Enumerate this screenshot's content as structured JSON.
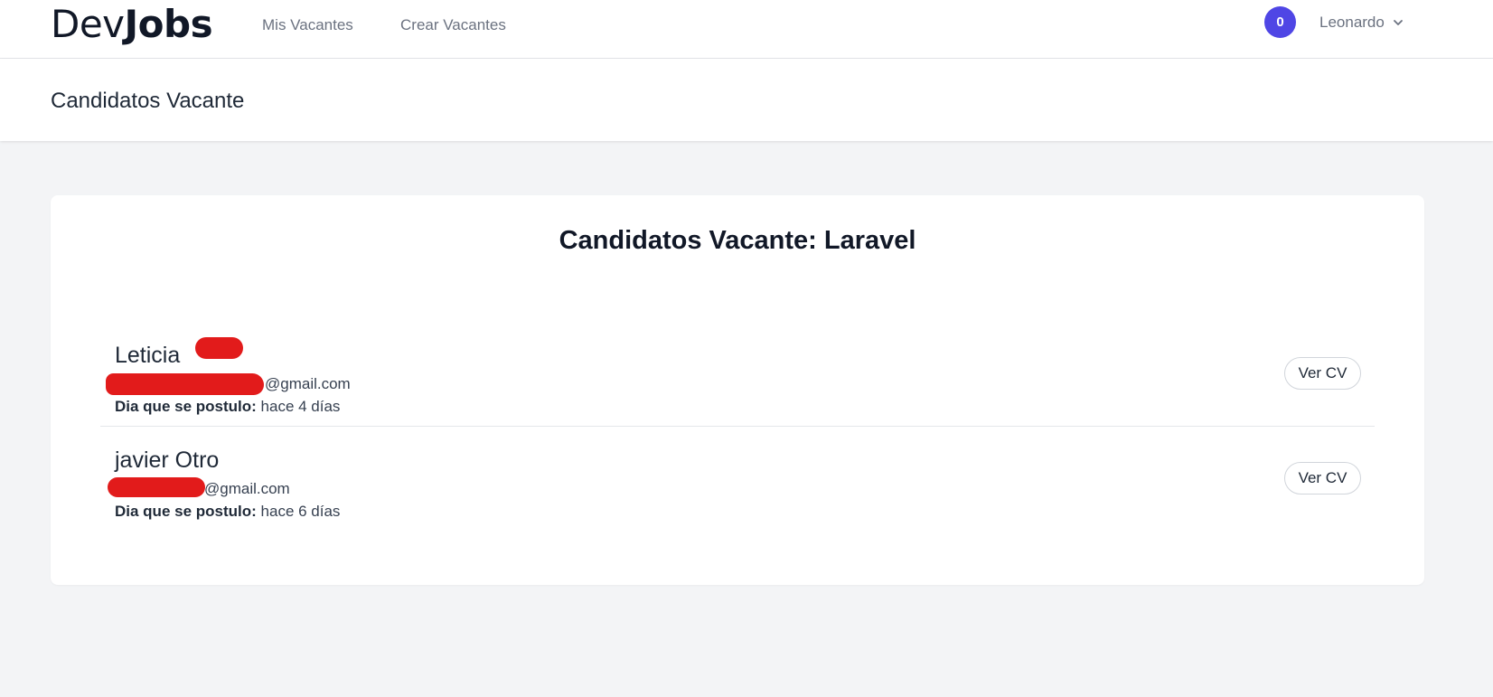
{
  "nav": {
    "logo_dev": "Dev",
    "logo_jobs": "Jobs",
    "links": [
      "Mis Vacantes",
      "Crear Vacantes"
    ],
    "notifications": "0",
    "user": "Leonardo",
    "user_icon": "chevron-down-icon"
  },
  "header": {
    "title": "Candidatos Vacante"
  },
  "main": {
    "title": "Candidatos Vacante: Laravel",
    "date_label": "Dia que se postulo:",
    "cv_button": "Ver CV",
    "candidates": [
      {
        "name": "Leticia",
        "email": "@gmail.com",
        "date": "hace 4 días"
      },
      {
        "name": "javier Otro",
        "email": "@gmail.com",
        "date": "hace 6 días"
      }
    ]
  },
  "colors": {
    "accent": "#4f46e5",
    "redaction": "#e21b1b",
    "background": "#f3f4f6"
  }
}
